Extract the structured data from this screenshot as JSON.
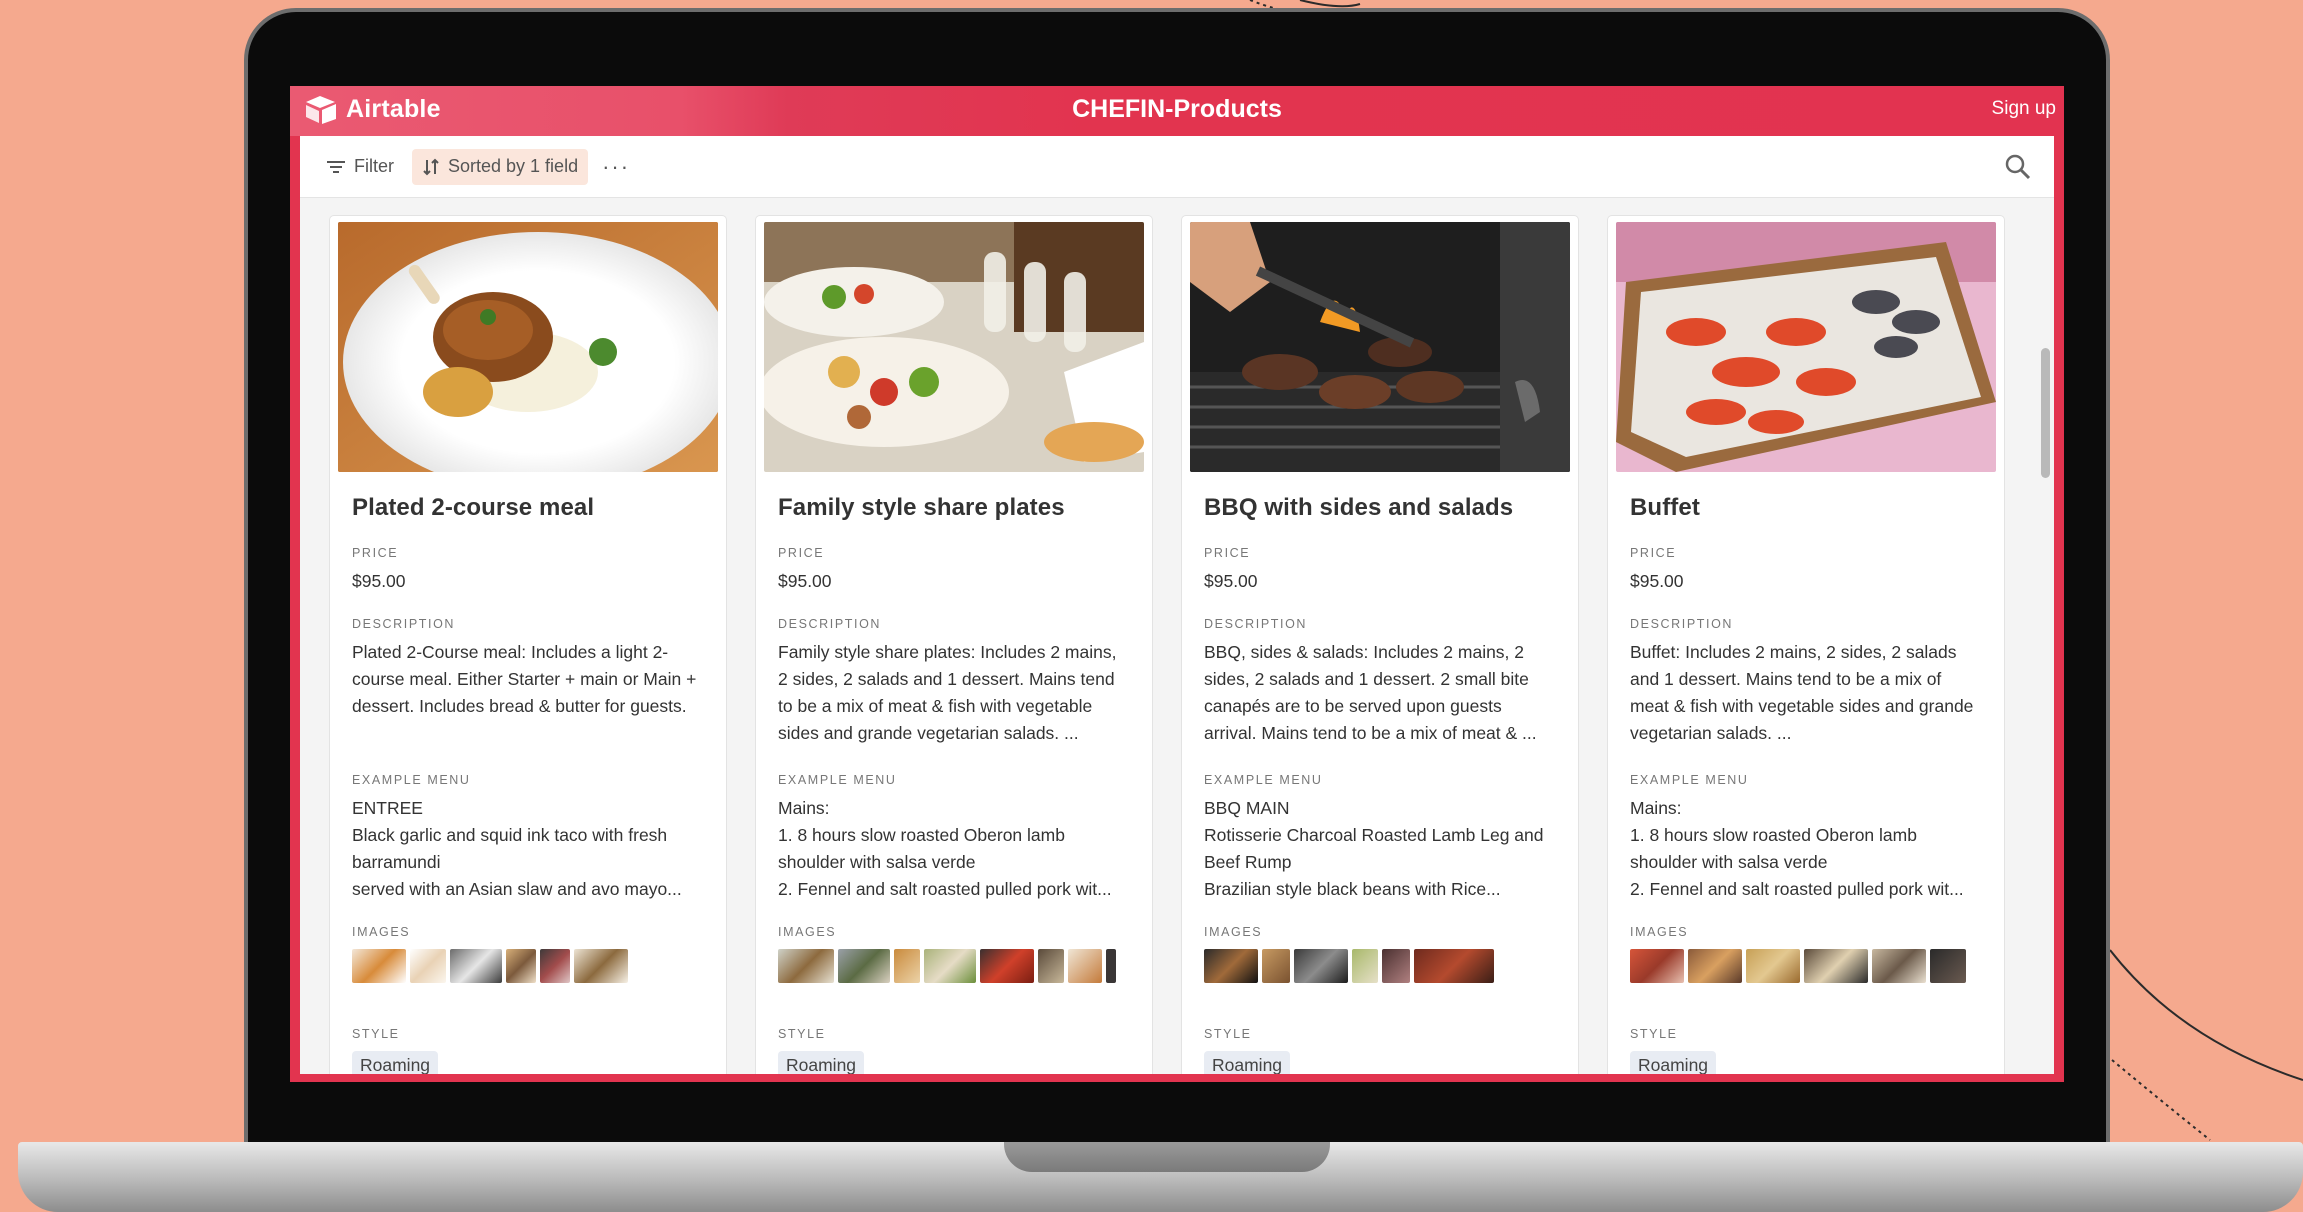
{
  "app": {
    "logo_text": "Airtable",
    "base_title": "CHEFIN-Products",
    "signup_label": "Sign up"
  },
  "toolbar": {
    "filter_label": "Filter",
    "sort_label": "Sorted by 1 field",
    "more_label": "···"
  },
  "labels": {
    "price": "PRICE",
    "description": "DESCRIPTION",
    "example_menu": "EXAMPLE MENU",
    "images": "IMAGES",
    "style": "STYLE"
  },
  "colors": {
    "brand_red": "#e2344f",
    "background_peach": "#f5a98e",
    "tag_background": "#e8ecf3"
  },
  "cards": [
    {
      "title": "Plated 2-course meal",
      "price": "$95.00",
      "description": "Plated 2-Course meal: Includes a light 2-course meal. Either Starter + main or Main + dessert. Includes bread & butter for guests.",
      "example_menu": [
        "ENTREE",
        "Black garlic and squid ink taco with fresh barramundi",
        "served with an Asian slaw and avo mayo..."
      ],
      "style": "Roaming",
      "image_count": 6
    },
    {
      "title": "Family style share plates",
      "price": "$95.00",
      "description": "Family style share plates: Includes 2 mains, 2 sides, 2 salads and 1 dessert. Mains tend to be a mix of meat & fish with vegetable sides and grande vegetarian salads. ...",
      "example_menu": [
        "Mains:",
        "1. 8 hours slow roasted Oberon lamb shoulder with salsa verde",
        "2. Fennel and salt roasted pulled pork wit..."
      ],
      "style": "Roaming",
      "image_count": 9
    },
    {
      "title": "BBQ with sides and salads",
      "price": "$95.00",
      "description": "BBQ, sides & salads: Includes 2 mains, 2 sides, 2 salads and 1 dessert. 2 small bite canapés are to be served upon guests arrival. Mains tend to be a mix of meat & ...",
      "example_menu": [
        "BBQ MAIN",
        "Rotisserie Charcoal Roasted Lamb Leg and Beef Rump",
        "Brazilian style black beans with Rice..."
      ],
      "style": "Roaming",
      "image_count": 7
    },
    {
      "title": "Buffet",
      "price": "$95.00",
      "description": "Buffet: Includes 2 mains, 2 sides, 2 salads and 1 dessert. Mains tend to be a mix of meat & fish with vegetable sides and grande vegetarian salads. ...",
      "example_menu": [
        "Mains:",
        "1. 8 hours slow roasted Oberon lamb shoulder with salsa verde",
        "2. Fennel and salt roasted pulled pork wit..."
      ],
      "style": "Roaming",
      "image_count": 6
    }
  ]
}
